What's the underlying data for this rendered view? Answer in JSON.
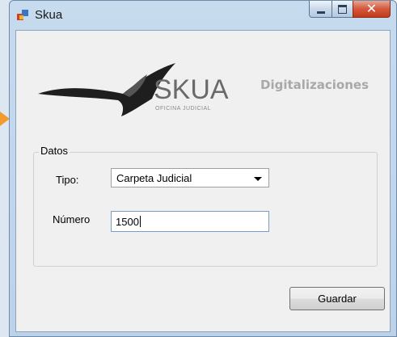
{
  "window": {
    "title": "Skua"
  },
  "logo": {
    "brand": "SKUA",
    "subtitle": "OFICINA JUDICIAL"
  },
  "header": {
    "title": "Digitalizaciones"
  },
  "group": {
    "legend": "Datos",
    "tipo_label": "Tipo:",
    "tipo_value": "Carpeta Judicial",
    "numero_label": "Número",
    "numero_value": "1500"
  },
  "buttons": {
    "save_label": "Guardar"
  },
  "colors": {
    "close_button": "#d4583c",
    "accent_arrow": "#f39a2e",
    "header_title": "#a8a8a8"
  }
}
